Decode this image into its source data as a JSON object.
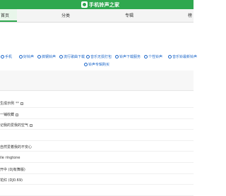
{
  "header": {
    "logo_text": "手机铃声之家"
  },
  "nav": {
    "items": [
      "首页",
      "分类",
      "专辑",
      "榜"
    ]
  },
  "tags": {
    "row1": [
      "手机",
      "好铃声",
      "搞钢铃声",
      "流行歌曲下载",
      "音乐无损打包",
      "铃声下载服务",
      "个性铃声",
      "音乐铃最新铃声"
    ],
    "row2": [
      "铃声专辑购买"
    ]
  },
  "list": [
    {
      "text": "生成示例",
      "mark": "**",
      "badge": true
    },
    {
      "text": "一铺收藏",
      "mark": "",
      "badge": true
    },
    {
      "text": "记我的爱我的空气",
      "mark": "",
      "badge": true
    },
    {
      "text": "",
      "mark": "",
      "badge": false
    },
    {
      "text": "自然爱着我的不安心",
      "mark": "",
      "badge": false
    },
    {
      "text": "ile ringtone",
      "mark": "",
      "badge": false
    },
    {
      "text": "开中 (DJ有舞版)",
      "mark": "",
      "badge": false
    },
    {
      "text": "花红 (DJ0.69)",
      "mark": "",
      "badge": false
    },
    {
      "text": "",
      "mark": "",
      "badge": false
    }
  ],
  "colors": {
    "brand": "#2fa84f",
    "link": "#1b66c9"
  }
}
